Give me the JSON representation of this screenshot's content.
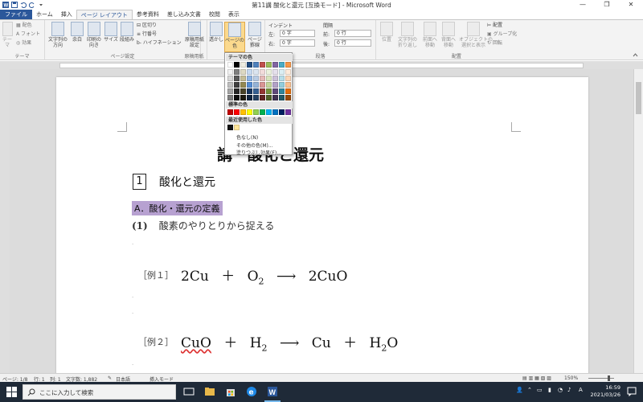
{
  "window": {
    "title": "第11講 酸化と還元 [互換モード] - Microsoft Word",
    "minimize": "—",
    "maximize": "❐",
    "close": "✕"
  },
  "tabs": [
    {
      "label": "ファイル",
      "kind": "file"
    },
    {
      "label": "ホーム"
    },
    {
      "label": "挿入"
    },
    {
      "label": "ページ レイアウト",
      "active": true
    },
    {
      "label": "参考資料"
    },
    {
      "label": "差し込み文書"
    },
    {
      "label": "校閲"
    },
    {
      "label": "表示"
    }
  ],
  "ribbon": {
    "theme_group": {
      "label": "テーマ",
      "theme_btn": "テーマ",
      "colors": "配色",
      "fonts": "フォント",
      "effects": "効果"
    },
    "page_setup": {
      "label": "ページ設定",
      "direction": "文字列の\n方向",
      "margins": "余白",
      "orientation": "印刷の\n向き",
      "size": "サイズ",
      "columns": "段組み",
      "breaks": "区切り",
      "line_numbers": "行番号",
      "hyphenation": "ハイフネーション"
    },
    "manuscript": {
      "label": "原稿用紙",
      "settings": "原稿用紙\n設定"
    },
    "background": {
      "watermark": "透かし",
      "page_color": "ページの色",
      "page_border": "ページ\n罫線"
    },
    "paragraph": {
      "label": "段落",
      "indent": "インデント",
      "spacing": "間隔",
      "left_label": "左:",
      "left_value": "0 字",
      "right_label": "右:",
      "right_value": "0 字",
      "before_label": "前:",
      "before_value": "0 行",
      "after_label": "後:",
      "after_value": "0 行"
    },
    "arrange": {
      "label": "配置",
      "position": "位置",
      "wrap": "文字列の\n折り返し",
      "forward": "前面へ\n移動",
      "backward": "背面へ\n移動",
      "selection": "オブジェクトの\n選択と表示",
      "align": "配置",
      "group": "グループ化",
      "rotate": "回転"
    }
  },
  "page_color_dropdown": {
    "theme_colors_header": "テーマの色",
    "standard_colors_header": "標準の色",
    "recent_colors_header": "最近使用した色",
    "no_color": "色なし(N)",
    "more_colors": "その他の色(M)...",
    "fill_effects": "塗りつぶし効果(F)...",
    "theme_top": [
      "#ffffff",
      "#000000",
      "#eeece1",
      "#1f497d",
      "#4f81bd",
      "#c0504d",
      "#9bbb59",
      "#8064a2",
      "#4bacc6",
      "#f79646"
    ],
    "theme_shades": [
      [
        "#f2f2f2",
        "#7f7f7f",
        "#ddd9c3",
        "#c6d9f0",
        "#dbe5f1",
        "#f2dcdb",
        "#ebf1dd",
        "#e5e0ec",
        "#dbeef3",
        "#fdeada"
      ],
      [
        "#d8d8d8",
        "#595959",
        "#c4bd97",
        "#8db3e2",
        "#b8cce4",
        "#e5b9b7",
        "#d7e3bc",
        "#ccc1d9",
        "#b7dde8",
        "#fbd5b5"
      ],
      [
        "#bfbfbf",
        "#3f3f3f",
        "#938953",
        "#548dd4",
        "#95b3d7",
        "#d99694",
        "#c3d69b",
        "#b2a2c7",
        "#92cddc",
        "#fac08f"
      ],
      [
        "#a5a5a5",
        "#262626",
        "#494429",
        "#17365d",
        "#366092",
        "#953734",
        "#76923c",
        "#5f497a",
        "#31859b",
        "#e36c09"
      ],
      [
        "#7f7f7f",
        "#0c0c0c",
        "#1d1b10",
        "#0f243e",
        "#244061",
        "#632423",
        "#4f6128",
        "#3f3151",
        "#205867",
        "#974806"
      ]
    ],
    "standard": [
      "#c00000",
      "#ff0000",
      "#ffc000",
      "#ffff00",
      "#92d050",
      "#00b050",
      "#00b0f0",
      "#0070c0",
      "#002060",
      "#7030a0"
    ],
    "recent": [
      "#111111",
      "#ffe599"
    ]
  },
  "document": {
    "title": "講　酸化と還元",
    "section_number": "1",
    "section_title": "酸化と還元",
    "subsection": "A．酸化・還元の定義",
    "para_num": "(1)",
    "para_text": "酸素のやりとりから捉える",
    "example1_label": "［例１］",
    "example2_label": "［例２］",
    "eq1_a": "2Cu",
    "eq1_plus": "＋",
    "eq1_b": "O",
    "eq1_b_sub": "2",
    "eq1_arrow": "⟶",
    "eq1_c": "2CuO",
    "eq2_a": "CuO",
    "eq2_plus1": "＋",
    "eq2_b": "H",
    "eq2_b_sub": "2",
    "eq2_arrow": "⟶",
    "eq2_c": "Cu",
    "eq2_plus2": "＋",
    "eq2_d": "H",
    "eq2_d_sub": "2",
    "eq2_d_tail": "O"
  },
  "status": {
    "page": "ページ: 1/8",
    "row": "行: 1",
    "col": "列: 1",
    "words": "文字数: 1,882",
    "lang": "日本語",
    "mode": "挿入モード",
    "zoom": "150%"
  },
  "taskbar": {
    "search_placeholder": "ここに入力して検索",
    "lang": "A",
    "time": "16:59",
    "date": "2021/03/26"
  }
}
